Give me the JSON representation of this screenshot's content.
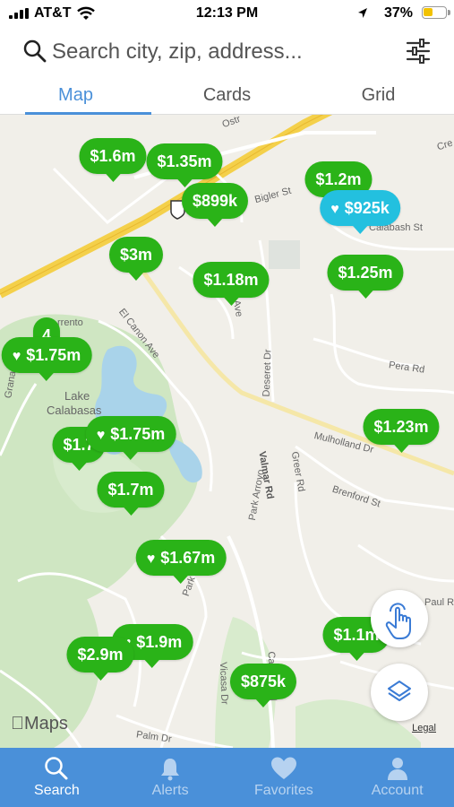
{
  "status": {
    "carrier": "AT&T",
    "time": "12:13 PM",
    "battery": "37%"
  },
  "search": {
    "placeholder": "Search city, zip, address..."
  },
  "tabs": [
    {
      "label": "Map",
      "active": true
    },
    {
      "label": "Cards",
      "active": false
    },
    {
      "label": "Grid",
      "active": false
    }
  ],
  "map": {
    "street_labels": [
      "Ostr",
      "Cre",
      "Bigler St",
      "Calabash St",
      "Pera Rd",
      "El Canon Ave",
      "Lake",
      "Calabasas",
      "Mulholland Dr",
      "Deseret Dr",
      "Valmar Rd",
      "Greer Rd",
      "Brenford St",
      "Park Arroyo",
      "Park",
      "Vicasa Dr",
      "Canyon Rd",
      "Paul R",
      "Palm Dr",
      "Granad",
      "rrento",
      "Ave"
    ],
    "pins": [
      {
        "label": "$1.6m",
        "favorite": false,
        "selected": false
      },
      {
        "label": "$1.35m",
        "favorite": false,
        "selected": false
      },
      {
        "label": "$899k",
        "favorite": false,
        "selected": false
      },
      {
        "label": "$1.2m",
        "favorite": false,
        "selected": false
      },
      {
        "label": "$925k",
        "favorite": true,
        "selected": true
      },
      {
        "label": "$3m",
        "favorite": false,
        "selected": false
      },
      {
        "label": "$1.18m",
        "favorite": false,
        "selected": false
      },
      {
        "label": "$1.25m",
        "favorite": false,
        "selected": false
      },
      {
        "label": "4",
        "favorite": false,
        "selected": false
      },
      {
        "label": "$1.75m",
        "favorite": true,
        "selected": false
      },
      {
        "label": "$1.7",
        "favorite": false,
        "selected": false
      },
      {
        "label": "$1.75m",
        "favorite": true,
        "selected": false
      },
      {
        "label": "$1.23m",
        "favorite": false,
        "selected": false
      },
      {
        "label": "$1.7m",
        "favorite": false,
        "selected": false
      },
      {
        "label": "$1.67m",
        "favorite": true,
        "selected": false
      },
      {
        "label": "$1.9m",
        "favorite": true,
        "selected": false
      },
      {
        "label": "$2.9m",
        "favorite": false,
        "selected": false
      },
      {
        "label": "$1.1m",
        "favorite": false,
        "selected": false
      },
      {
        "label": "$875k",
        "favorite": false,
        "selected": false
      }
    ],
    "logo": "Maps",
    "legal": "Legal",
    "icons": [
      "hand-draw-icon",
      "layers-icon"
    ]
  },
  "nav": [
    {
      "label": "Search",
      "icon": "search-icon",
      "active": true
    },
    {
      "label": "Alerts",
      "icon": "bell-icon",
      "active": false
    },
    {
      "label": "Favorites",
      "icon": "heart-icon",
      "active": false
    },
    {
      "label": "Account",
      "icon": "person-icon",
      "active": false
    }
  ],
  "colors": {
    "accent": "#4a90d9",
    "pin": "#2ab318",
    "pin_selected": "#23c0df"
  }
}
